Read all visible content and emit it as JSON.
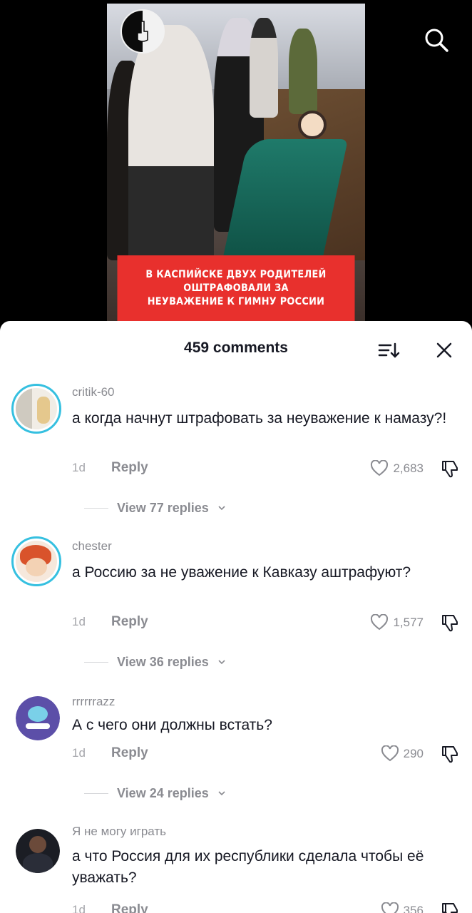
{
  "video": {
    "caption_lines": [
      "В КАСПИЙСКЕ ДВУХ РОДИТЕЛЕЙ",
      "ОШТРАФОВАЛИ ЗА",
      "НЕУВАЖЕНИЕ К ГИМНУ РОССИИ"
    ]
  },
  "header": {
    "comments_count": "459 comments"
  },
  "comments": [
    {
      "username": "critik-60",
      "text": "а когда начнут штрафовать за неуважение к намазу?!",
      "time": "1d",
      "reply_label": "Reply",
      "likes": "2,683",
      "replies_label": "View 77 replies"
    },
    {
      "username": "chester",
      "text": "а Россию за не уважение к Кавказу аштрафуют?",
      "time": "1d",
      "reply_label": "Reply",
      "likes": "1,577",
      "replies_label": "View 36 replies"
    },
    {
      "username": "rrrrrrazz",
      "text": "А с чего они должны встать?",
      "time": "1d",
      "reply_label": "Reply",
      "likes": "290",
      "replies_label": "View 24 replies"
    },
    {
      "username": "Я не могу играть",
      "text": "а что Россия для их республики сделала чтобы её уважать?",
      "time": "1d",
      "reply_label": "Reply",
      "likes": "356"
    }
  ],
  "colors": {
    "caption_bg": "#e8302d",
    "avatar_ring": "#36c0e0",
    "text_primary": "#161823",
    "text_secondary": "#8a8b91"
  }
}
